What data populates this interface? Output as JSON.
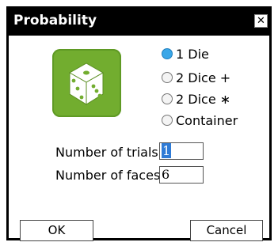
{
  "dialog": {
    "title": "Probability",
    "close_glyph": "✕"
  },
  "icon": {
    "name": "dice-icon",
    "color": "#72ad2f"
  },
  "options": [
    {
      "label": "1 Die",
      "selected": true
    },
    {
      "label": "2 Dice +",
      "selected": false
    },
    {
      "label": "2 Dice ∗",
      "selected": false
    },
    {
      "label": "Container",
      "selected": false
    }
  ],
  "fields": {
    "trials_label": "Number of trials",
    "trials_value": "1",
    "faces_label": "Number of faces",
    "faces_value": "6"
  },
  "buttons": {
    "ok": "OK",
    "cancel": "Cancel"
  },
  "colors": {
    "selected_radio": "#3aa7e8",
    "selection": "#2f7bd6"
  }
}
